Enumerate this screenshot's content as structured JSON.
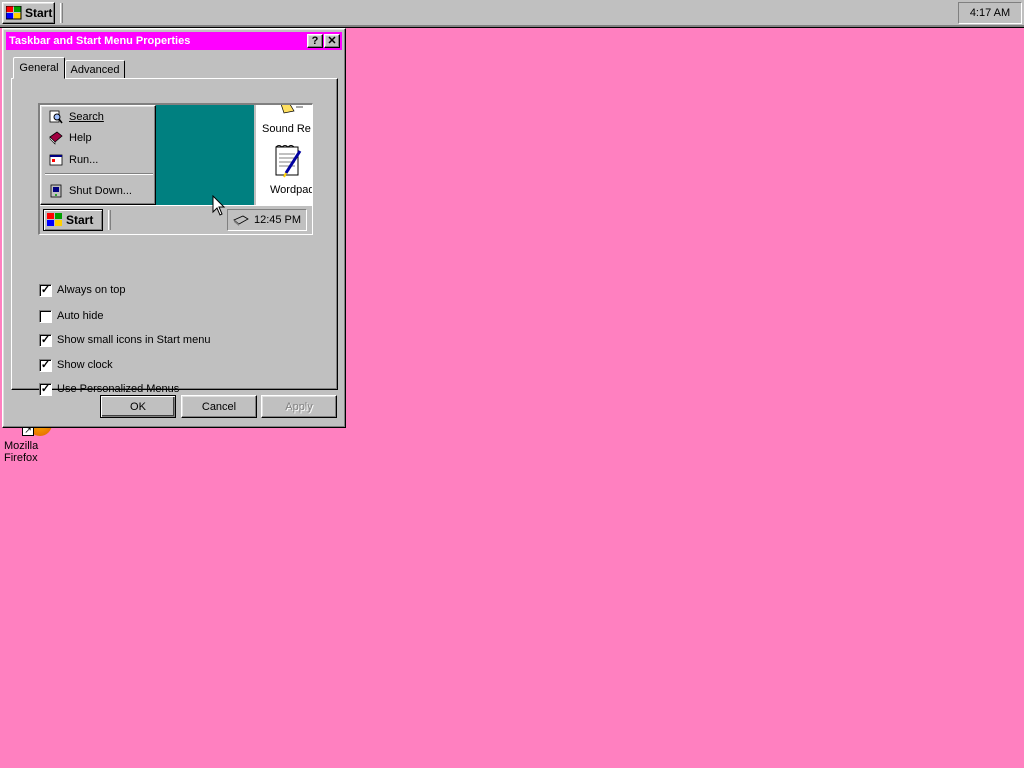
{
  "taskbar": {
    "start_label": "Start",
    "clock": "4:17 AM"
  },
  "desktop": {
    "icons": [
      {
        "label": "Mozilla Firefox",
        "icon": "firefox-icon"
      }
    ]
  },
  "dialog": {
    "title": "Taskbar and Start Menu Properties",
    "help_btn": "?",
    "close_btn": "✕",
    "tabs": [
      {
        "label": "General",
        "active": true
      },
      {
        "label": "Advanced",
        "active": false
      }
    ],
    "preview": {
      "menu_items": [
        {
          "label": "Search",
          "icon": "search-icon"
        },
        {
          "label": "Help",
          "icon": "help-book-icon"
        },
        {
          "label": "Run...",
          "icon": "run-icon"
        },
        {
          "label": "Shut Down...",
          "icon": "shutdown-icon"
        }
      ],
      "apps": [
        {
          "label": "Sound Re",
          "icon": "speaker-icon"
        },
        {
          "label": "Wordpad",
          "icon": "wordpad-icon"
        }
      ],
      "start_label": "Start",
      "clock": "12:45 PM",
      "background_color": "#008080"
    },
    "options": [
      {
        "label": "Always on top",
        "checked": true
      },
      {
        "label": "Auto hide",
        "checked": false
      },
      {
        "label": "Show small icons in Start menu",
        "checked": true
      },
      {
        "label": "Show clock",
        "checked": true
      },
      {
        "label": "Use Personalized Menus",
        "checked": true
      }
    ],
    "buttons": {
      "ok": "OK",
      "cancel": "Cancel",
      "apply": "Apply"
    }
  },
  "colors": {
    "desktop": "#ff80c0",
    "title_bar": "#ff00ff",
    "face": "#c0c0c0"
  }
}
